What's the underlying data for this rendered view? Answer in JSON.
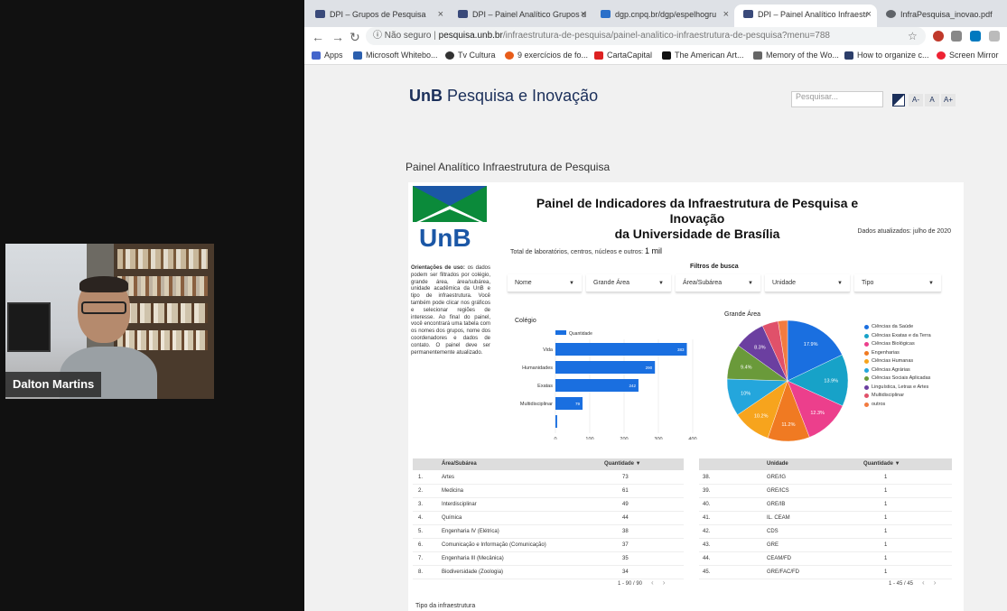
{
  "meeting": {
    "participant_name": "Dalton Martins"
  },
  "browser": {
    "tabs": [
      {
        "label": "DPI – Grupos de Pesquisa",
        "active": false
      },
      {
        "label": "DPI – Painel Analítico Grupos d",
        "active": false
      },
      {
        "label": "dgp.cnpq.br/dgp/espelhogru",
        "active": false
      },
      {
        "label": "DPI – Painel Analítico Infraestr",
        "active": true
      },
      {
        "label": "InfraPesquisa_inovao.pdf",
        "active": false
      }
    ],
    "address": {
      "security": "Não seguro",
      "separator": "|",
      "host": "pesquisa.unb.br",
      "path": "/infraestrutura-de-pesquisa/painel-analitico-infraestrutura-de-pesquisa?menu=788"
    },
    "bookmarks": [
      "Apps",
      "Microsoft Whitebo...",
      "Tv Cultura",
      "9 exercícios de fo...",
      "CartaCapital",
      "The American Art...",
      "Memory of the Wo...",
      "How to organize c...",
      "Screen Mirror"
    ]
  },
  "site": {
    "title_bold": "UnB",
    "title_rest": " Pesquisa e Inovação",
    "search_placeholder": "Pesquisar...",
    "font_buttons": [
      "A-",
      "A",
      "A+"
    ],
    "section_title": "Painel Analítico Infraestrutura de Pesquisa"
  },
  "dashboard": {
    "logo_text": "UnB",
    "title_line1": "Painel de Indicadores da Infraestrutura de Pesquisa e Inovação",
    "title_line2": "da Universidade de Brasília",
    "updated": "Dados atualizados: julho de 2020",
    "total_label": "Total de laboratórios, centros, núcleos e outros:",
    "total_value": "1 mil",
    "instructions_title": "Orientações de uso:",
    "instructions_body": " os dados podem ser filtrados por colégio, grande área, área/subárea, unidade acadêmica da UnB e tipo de infraestrutura. Você também pode clicar nos gráficos e selecionar regiões de interesse. Ao final do painel, você encontrará uma tabela com os nomes dos grupos, nome dos coordenadores e dados de contato. O painel deve ser permanentemente atualizado.",
    "filters_title": "Filtros de busca",
    "filters": [
      "Nome",
      "Grande Área",
      "Área/Subárea",
      "Unidade",
      "Tipo"
    ],
    "bar_title": "Colégio",
    "pie_title": "Grande Área",
    "infra_label": "Tipo da infraestrutura"
  },
  "chart_data": [
    {
      "type": "bar",
      "title": "Colégio",
      "legend": [
        "Quantidade"
      ],
      "categories": [
        "Vida",
        "Humanidades",
        "Exatas",
        "Multidisciplinar",
        ""
      ],
      "values": [
        383,
        290,
        242,
        79,
        5
      ],
      "xlim": [
        0,
        400
      ],
      "xticks": [
        "0",
        "100",
        "200",
        "300",
        "400"
      ],
      "value_labels": [
        "383",
        "290",
        "242",
        "79",
        ""
      ],
      "colors": {
        "bar": "#1a6fe0"
      }
    },
    {
      "type": "pie",
      "title": "Grande Área",
      "slices": [
        {
          "label": "Ciências da Saúde",
          "value": 17.9,
          "color": "#1a6fe0"
        },
        {
          "label": "Ciências Exatas e da Terra",
          "value": 13.9,
          "color": "#17a2c8"
        },
        {
          "label": "Ciências Biológicas",
          "value": 12.3,
          "color": "#ec3f8c"
        },
        {
          "label": "Engenharias",
          "value": 11.2,
          "color": "#f07a22"
        },
        {
          "label": "Ciências Humanas",
          "value": 10.2,
          "color": "#f7a41d"
        },
        {
          "label": "Ciências Agrárias",
          "value": 10,
          "color": "#24a6dc"
        },
        {
          "label": "Ciências Sociais Aplicadas",
          "value": 9.4,
          "color": "#6a9a3a"
        },
        {
          "label": "Linguística, Letras e Artes",
          "value": 8.3,
          "color": "#6b3fa0"
        },
        {
          "label": "Multidisciplinar",
          "value": 4.3,
          "color": "#e0516a"
        },
        {
          "label": "outros",
          "value": 2.5,
          "color": "#f27b40"
        }
      ],
      "slice_labels": [
        "17.9%",
        "13.9%",
        "12.3%",
        "11.2%",
        "10.2%",
        "10%",
        "9.4%",
        "8.3%",
        "",
        ""
      ]
    }
  ],
  "table_area": {
    "headers": [
      "Área/Subárea",
      "Quantidade ▼"
    ],
    "rows": [
      [
        "1.",
        "Artes",
        "73"
      ],
      [
        "2.",
        "Medicina",
        "61"
      ],
      [
        "3.",
        "Interdisciplinar",
        "49"
      ],
      [
        "4.",
        "Química",
        "44"
      ],
      [
        "5.",
        "Engenharia IV (Elétrica)",
        "38"
      ],
      [
        "6.",
        "Comunicação e Informação (Comunicação)",
        "37"
      ],
      [
        "7.",
        "Engenharia III (Mecânica)",
        "35"
      ],
      [
        "8.",
        "Biodiversidade (Zoologia)",
        "34"
      ]
    ],
    "pager": "1 - 90 / 90"
  },
  "table_unit": {
    "headers": [
      "Unidade",
      "Quantidade ▼"
    ],
    "rows": [
      [
        "38.",
        "GRE/IG",
        "1"
      ],
      [
        "39.",
        "GRE/ICS",
        "1"
      ],
      [
        "40.",
        "GRE/IB",
        "1"
      ],
      [
        "41.",
        "IL. CEAM",
        "1"
      ],
      [
        "42.",
        "CDS",
        "1"
      ],
      [
        "43.",
        "GRE",
        "1"
      ],
      [
        "44.",
        "CEAM/FD",
        "1"
      ],
      [
        "45.",
        "GRE/FAC/FD",
        "1"
      ]
    ],
    "pager": "1 - 45 / 45"
  }
}
